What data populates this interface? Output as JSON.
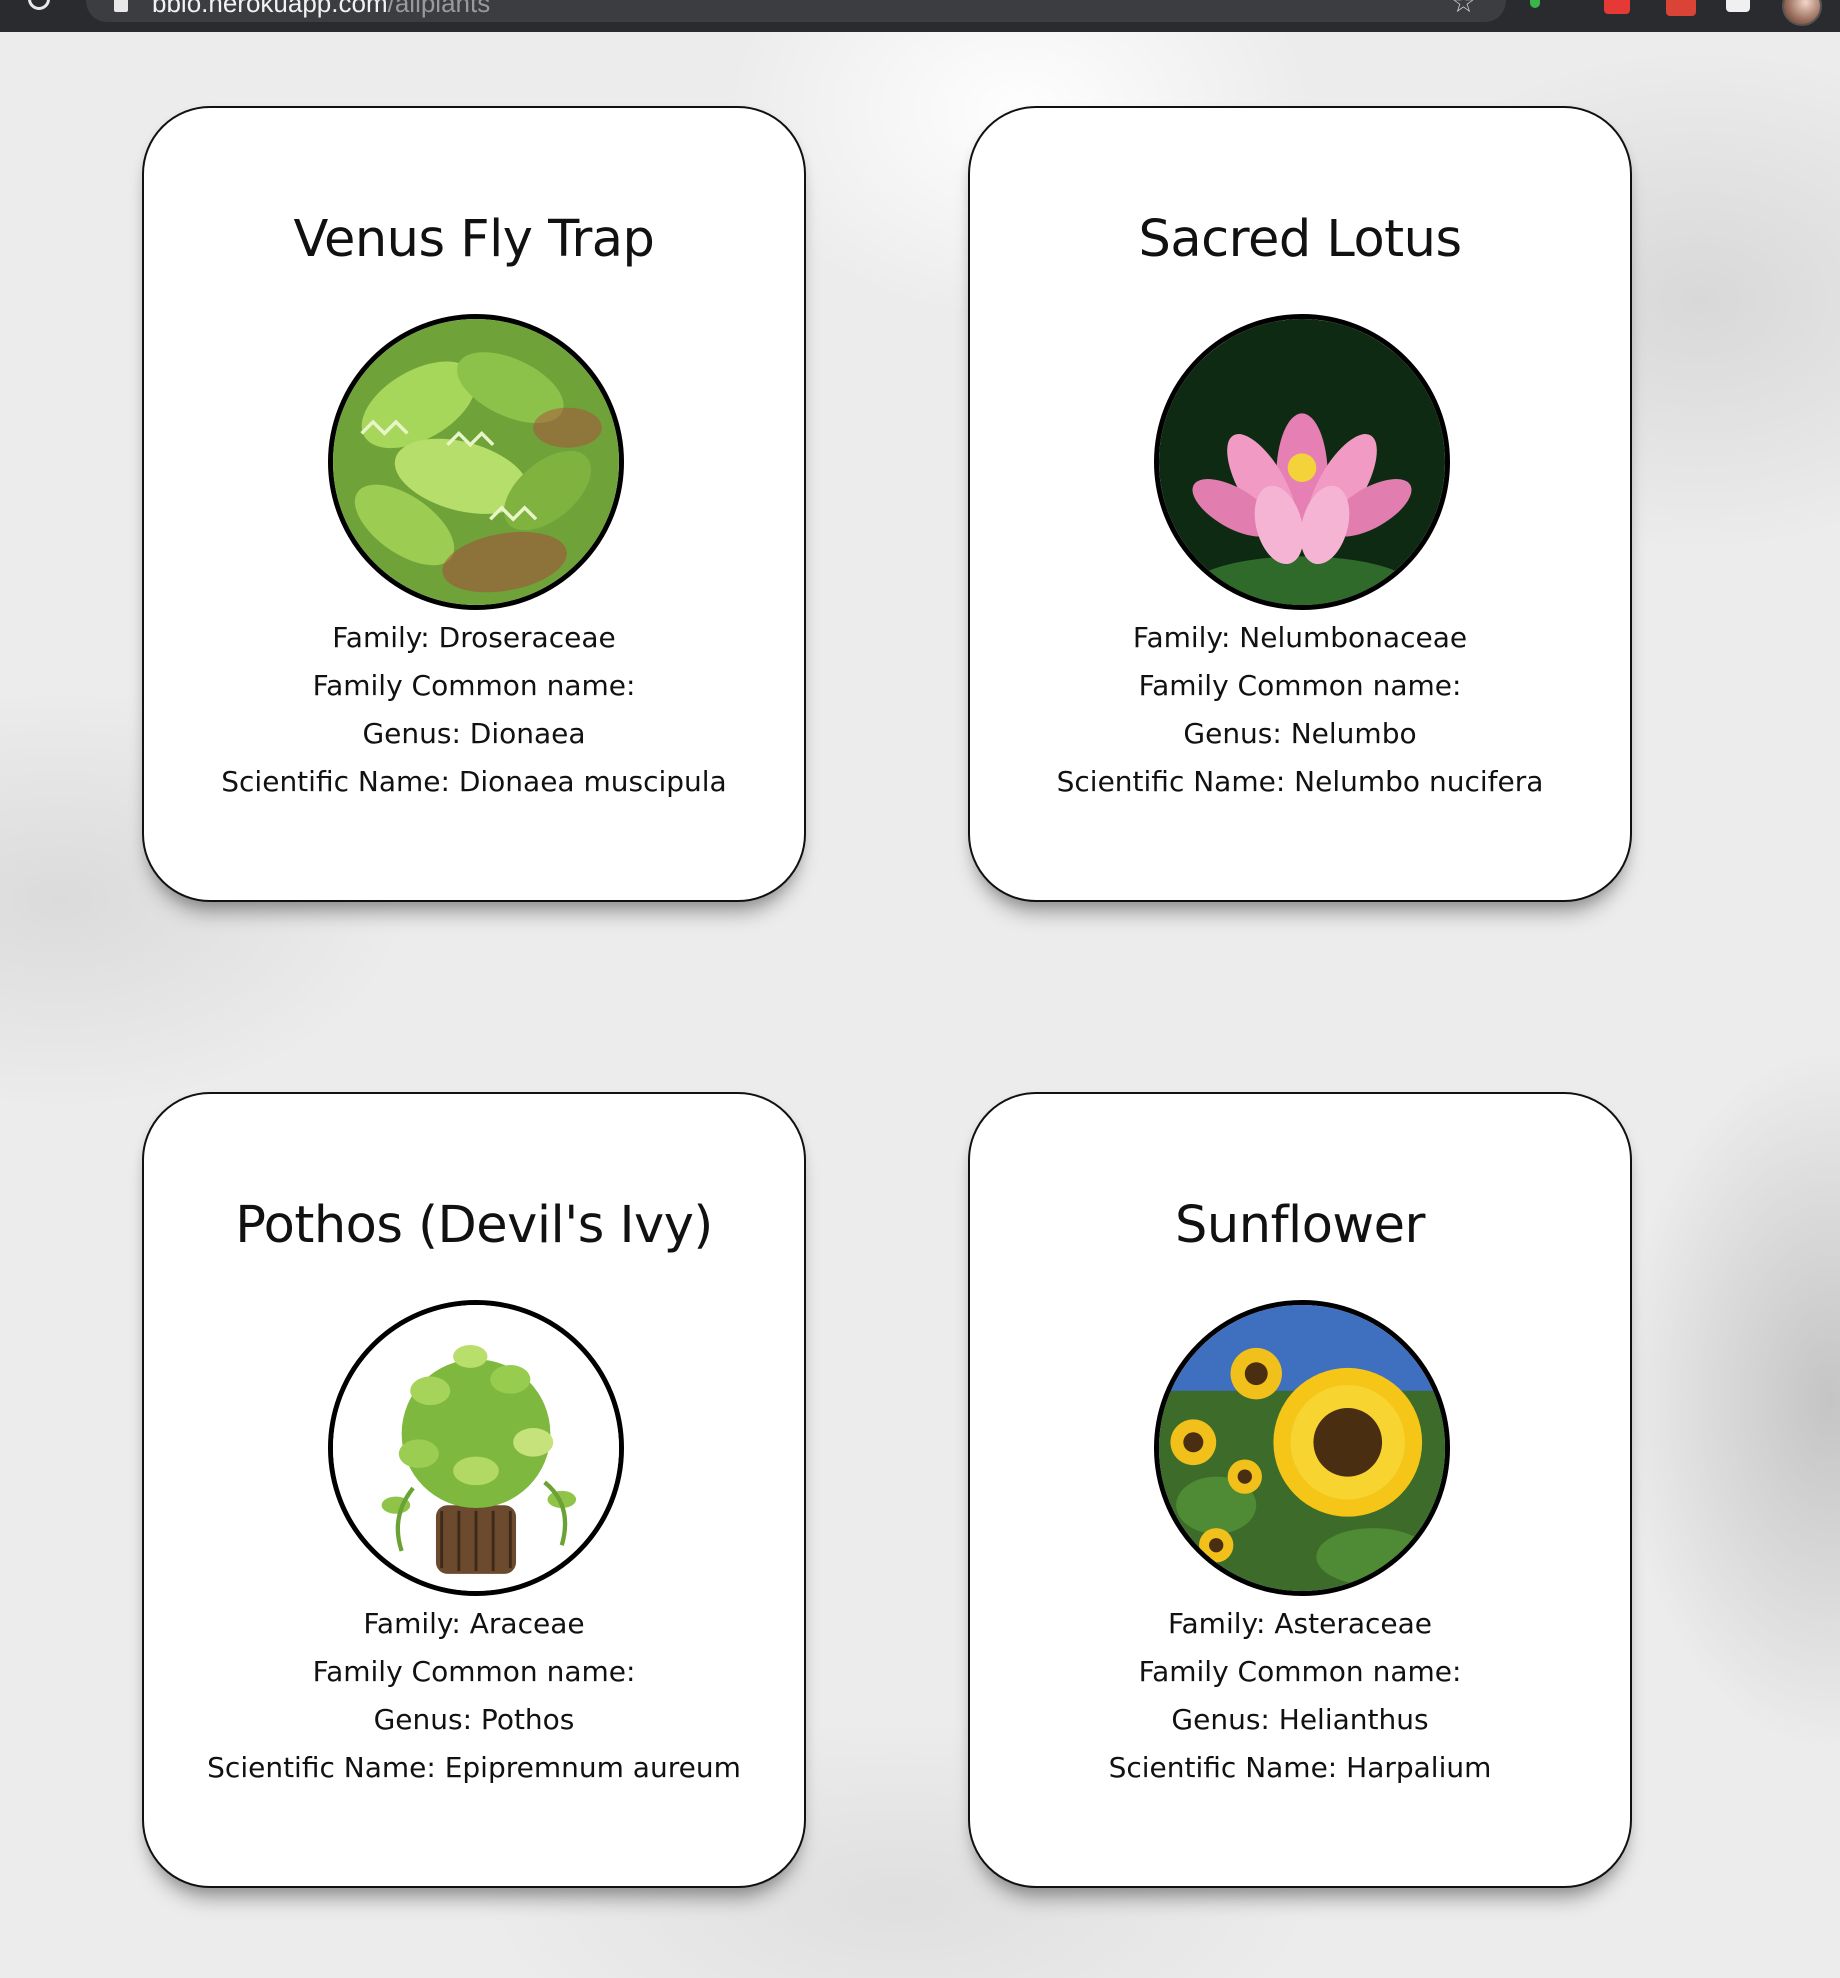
{
  "browser": {
    "url_host": "bbio.herokuapp.com",
    "url_path": "/allplants"
  },
  "plants": [
    {
      "name": "Venus Fly Trap",
      "family": "Family: Droseraceae",
      "family_common_name": "Family Common name:",
      "genus": "Genus: Dionaea",
      "scientific_name": "Scientific Name: Dionaea muscipula"
    },
    {
      "name": "Sacred Lotus",
      "family": "Family: Nelumbonaceae",
      "family_common_name": "Family Common name:",
      "genus": "Genus: Nelumbo",
      "scientific_name": "Scientific Name: Nelumbo nucifera"
    },
    {
      "name": "Pothos (Devil's Ivy)",
      "family": "Family: Araceae",
      "family_common_name": "Family Common name:",
      "genus": "Genus: Pothos",
      "scientific_name": "Scientific Name: Epipremnum aureum"
    },
    {
      "name": "Sunflower",
      "family": "Family: Asteraceae",
      "family_common_name": "Family Common name:",
      "genus": "Genus: Helianthus",
      "scientific_name": "Scientific Name: Harpalium"
    }
  ]
}
